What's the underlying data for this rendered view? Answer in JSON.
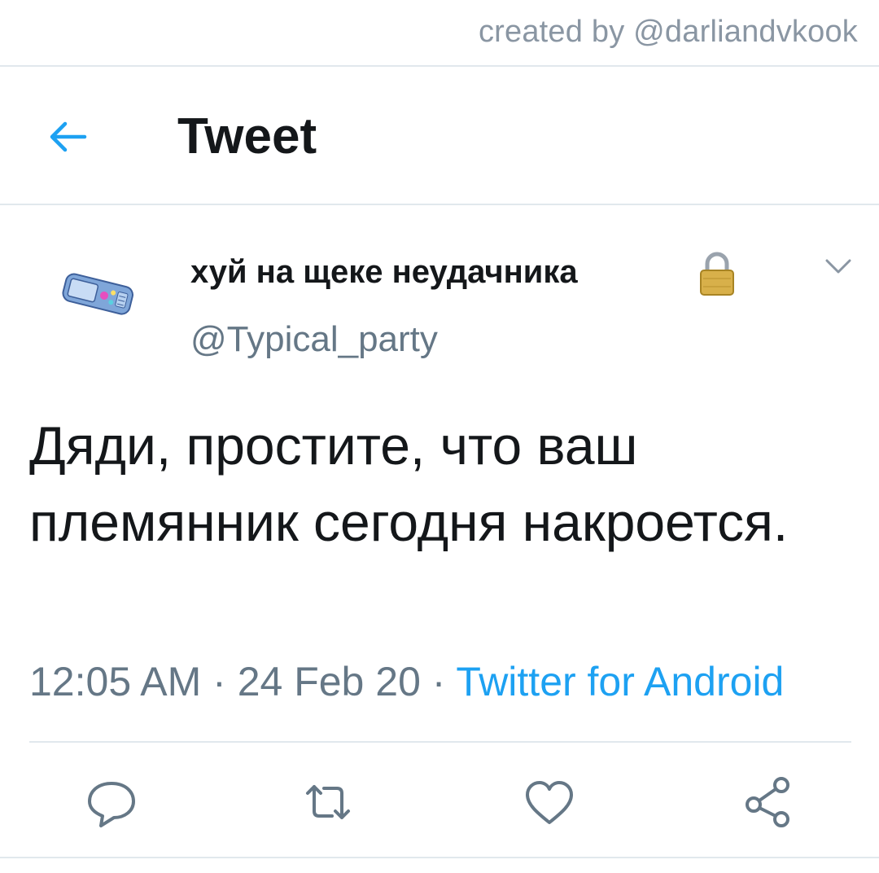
{
  "credit": {
    "text": "created by @darliandvkook"
  },
  "header": {
    "title": "Tweet",
    "back_icon": "arrow-left-icon"
  },
  "tweet": {
    "author": {
      "display_name": "хуй на щеке неудачника",
      "handle": "@Typical_party",
      "protected_icon": "lock-icon",
      "avatar": "avatar"
    },
    "text": "Дяди, простите, что ваш племянник сегодня накроется.",
    "time": "12:05 AM",
    "date": "24 Feb 20",
    "separator": " · ",
    "source": "Twitter for Android",
    "more_icon": "chevron-down-icon"
  },
  "actions": {
    "items": [
      {
        "icon": "reply-icon"
      },
      {
        "icon": "retweet-icon"
      },
      {
        "icon": "like-icon"
      },
      {
        "icon": "share-icon"
      }
    ]
  },
  "colors": {
    "accent": "#1da1f2",
    "text": "#14171a",
    "secondary": "#657786",
    "border": "#e1e8ed"
  }
}
